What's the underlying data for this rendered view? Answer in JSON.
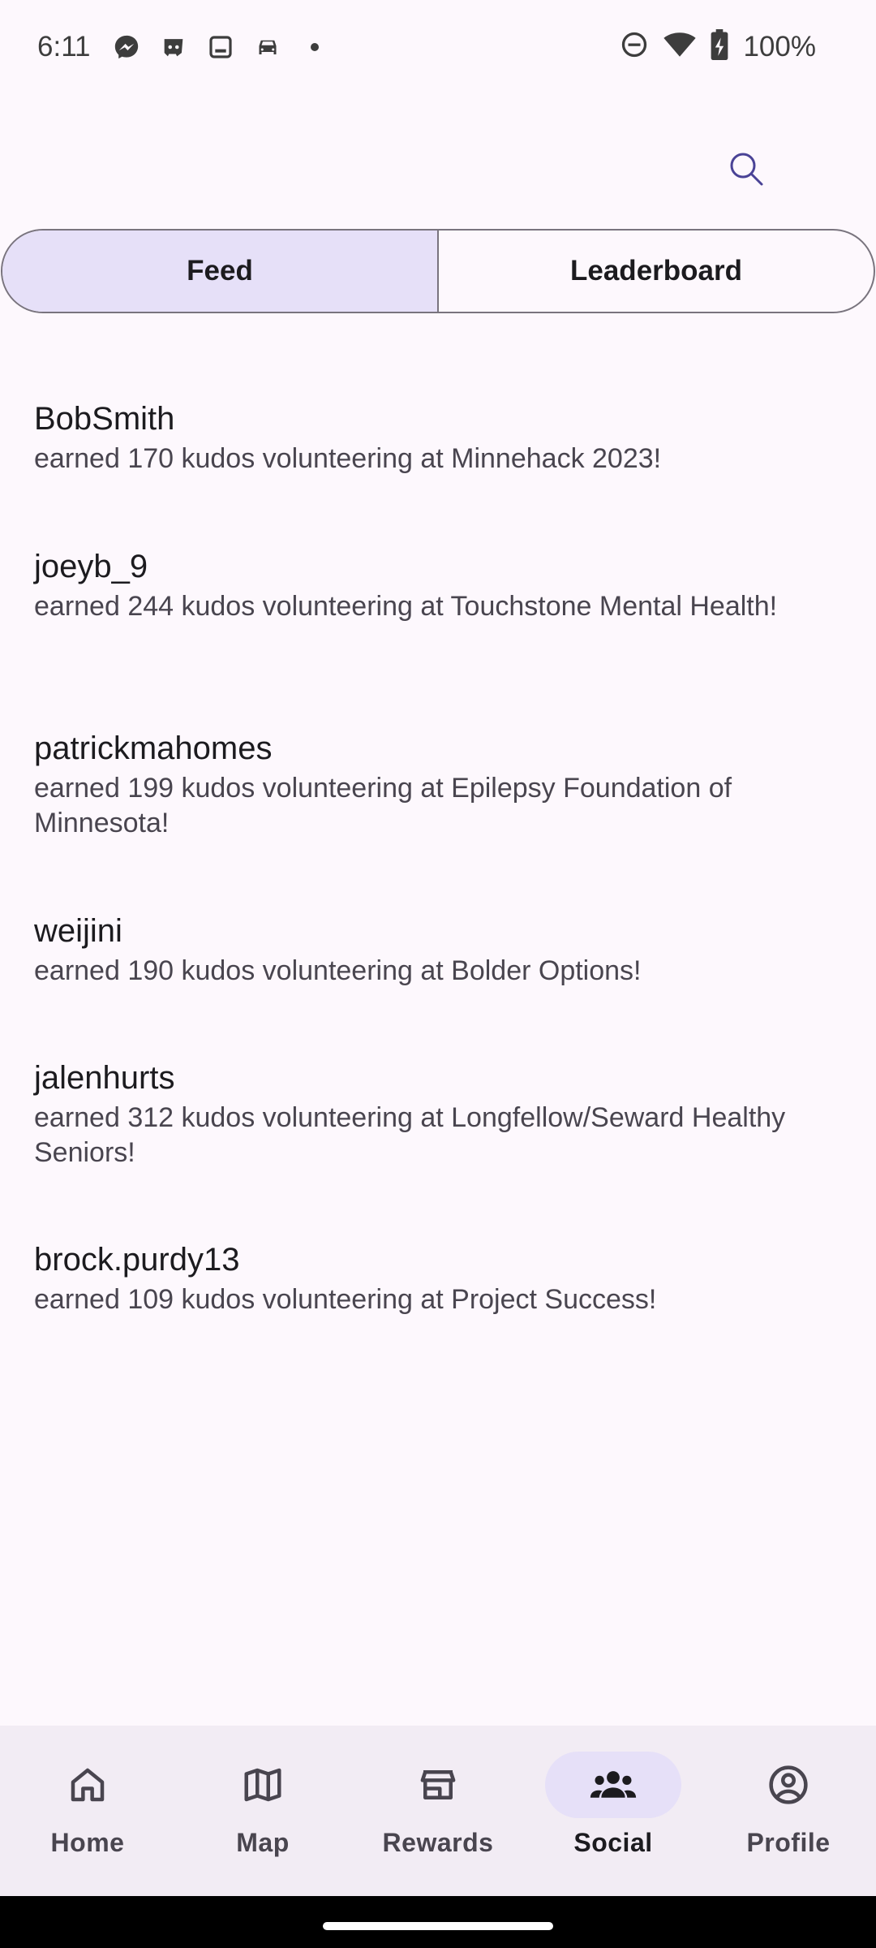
{
  "status_bar": {
    "time": "6:11",
    "battery": "100%",
    "icons": [
      "messenger-icon",
      "discord-icon",
      "tablet-icon",
      "car-icon",
      "dot-icon",
      "dnd-icon",
      "wifi-icon",
      "battery-icon"
    ]
  },
  "tabs": [
    {
      "label": "Feed",
      "selected": true
    },
    {
      "label": "Leaderboard",
      "selected": false
    }
  ],
  "feed": [
    {
      "user": "BobSmith",
      "text": "earned 170 kudos volunteering at Minnehack 2023!"
    },
    {
      "user": "joeyb_9",
      "text": "earned 244 kudos volunteering at Touchstone Mental Health!"
    },
    {
      "user": "patrickmahomes",
      "text": "earned 199 kudos volunteering at Epilepsy Foundation of Minnesota!"
    },
    {
      "user": "weijini",
      "text": "earned 190 kudos volunteering at Bolder Options!"
    },
    {
      "user": "jalenhurts",
      "text": "earned 312 kudos volunteering at Longfellow/Seward Healthy Seniors!"
    },
    {
      "user": "brock.purdy13",
      "text": "earned 109 kudos volunteering at Project Success!"
    }
  ],
  "nav": [
    {
      "label": "Home",
      "icon": "home-icon"
    },
    {
      "label": "Map",
      "icon": "map-icon"
    },
    {
      "label": "Rewards",
      "icon": "store-icon"
    },
    {
      "label": "Social",
      "icon": "group-icon",
      "active": true
    },
    {
      "label": "Profile",
      "icon": "account-icon"
    }
  ],
  "colors": {
    "background": "#fdf8fd",
    "accent_container": "#e6e0f8",
    "nav_background": "#f2ecf4",
    "search_icon": "#4a4396"
  }
}
